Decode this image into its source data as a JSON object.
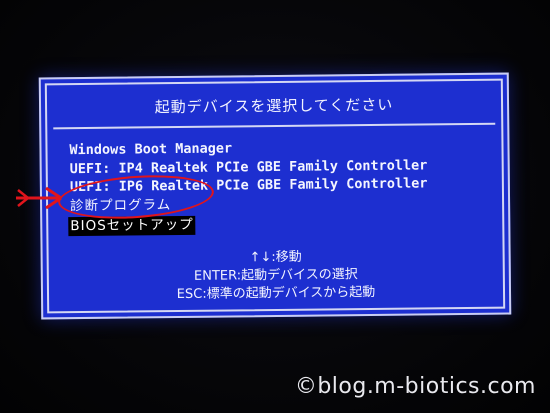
{
  "dialog": {
    "title": "起動デバイスを選択してください",
    "items": [
      {
        "label": "Windows Boot Manager"
      },
      {
        "label": "UEFI: IP4 Realtek PCIe GBE Family Controller"
      },
      {
        "label": "UEFI: IP6 Realtek PCIe GBE Family Controller"
      },
      {
        "label": "診断プログラム"
      },
      {
        "label": "BIOSセットアップ"
      }
    ],
    "help": {
      "move": "↑↓:移動",
      "enter": "ENTER:起動デバイスの選択",
      "esc": "ESC:標準の起動デバイスから起動"
    }
  },
  "colors": {
    "screen_blue": "#1d2fd0",
    "annotation_red": "#e0141c"
  },
  "watermark": "©blog.m-biotics.com"
}
